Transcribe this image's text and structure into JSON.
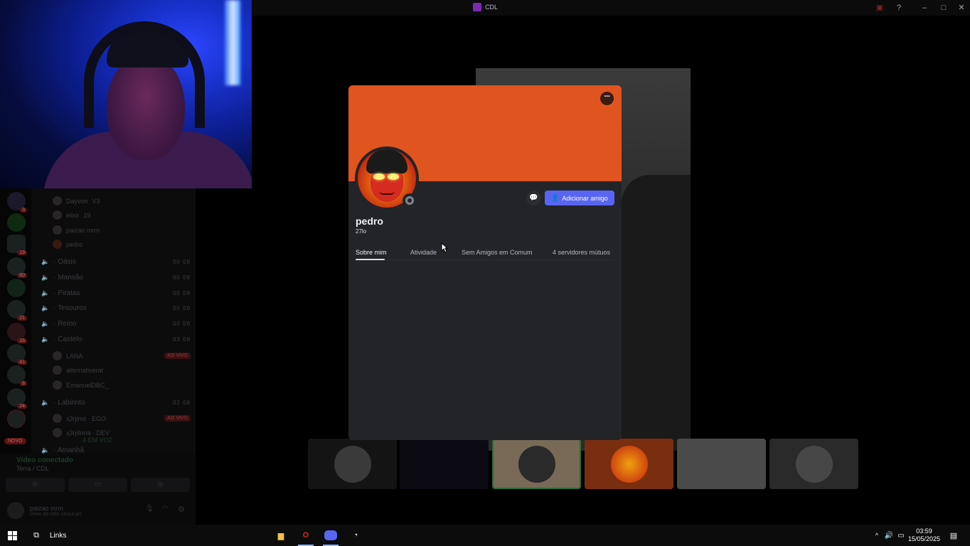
{
  "window": {
    "title": "CDL"
  },
  "servers": [
    {
      "badge": "3"
    },
    {
      "badge": ""
    },
    {
      "badge": "19"
    },
    {
      "badge": "60"
    },
    {
      "badge": ""
    },
    {
      "badge": "21"
    },
    {
      "badge": "16"
    },
    {
      "badge": "41"
    },
    {
      "badge": "8"
    },
    {
      "badge": "24"
    },
    {
      "badge": ""
    }
  ],
  "new_badge": "NOVO",
  "channels": {
    "users_top": [
      {
        "name": "Dayvon",
        "tag": "V3"
      },
      {
        "name": "elixir",
        "tag": "19"
      },
      {
        "name": "paizao mrm",
        "tag": ""
      },
      {
        "name": "pedro",
        "tag": ""
      }
    ],
    "voice": [
      {
        "name": "· Oásis",
        "count": "00 08"
      },
      {
        "name": "· Mansão",
        "count": "00 08"
      },
      {
        "name": "· Piratas",
        "count": "00 08"
      },
      {
        "name": "· Tesouros",
        "count": "00 08"
      },
      {
        "name": "· Reino",
        "count": "00 08"
      },
      {
        "name": "· Castelo",
        "count": "03 08"
      }
    ],
    "castelo_users": [
      {
        "name": "LANA",
        "live": "AO VIVO"
      },
      {
        "name": "alternativerat",
        "live": ""
      },
      {
        "name": "EmanuelDBC_",
        "live": ""
      }
    ],
    "labirinto": {
      "name": "· Labirinto",
      "count": "02 08"
    },
    "labirinto_users": [
      {
        "name": "ҳ3rjimii · EGO",
        "live": "AO VIVO"
      },
      {
        "name": "ҳ3rj4nna · DEV",
        "live": ""
      }
    ],
    "in_voice": "4 EM VOZ",
    "next": "· Amanhã"
  },
  "voice_panel": {
    "title": "Vídeo conectado",
    "subtitle": "Terra / CDL",
    "user_name": "paizao mrm",
    "user_status": "cheio de ódio nessa prr"
  },
  "profile": {
    "name": "pedro",
    "tag": "27lo",
    "add_friend_label": "Adicionar amigo",
    "more_label": "···",
    "tabs": [
      "Sobre mim",
      "Atividade",
      "Sem Amigos em Comum",
      "4 servidores mútuos"
    ],
    "banner_color": "#e05420"
  },
  "taskbar": {
    "search_label": "Links",
    "time": "03:59",
    "date": "15/05/2025"
  }
}
